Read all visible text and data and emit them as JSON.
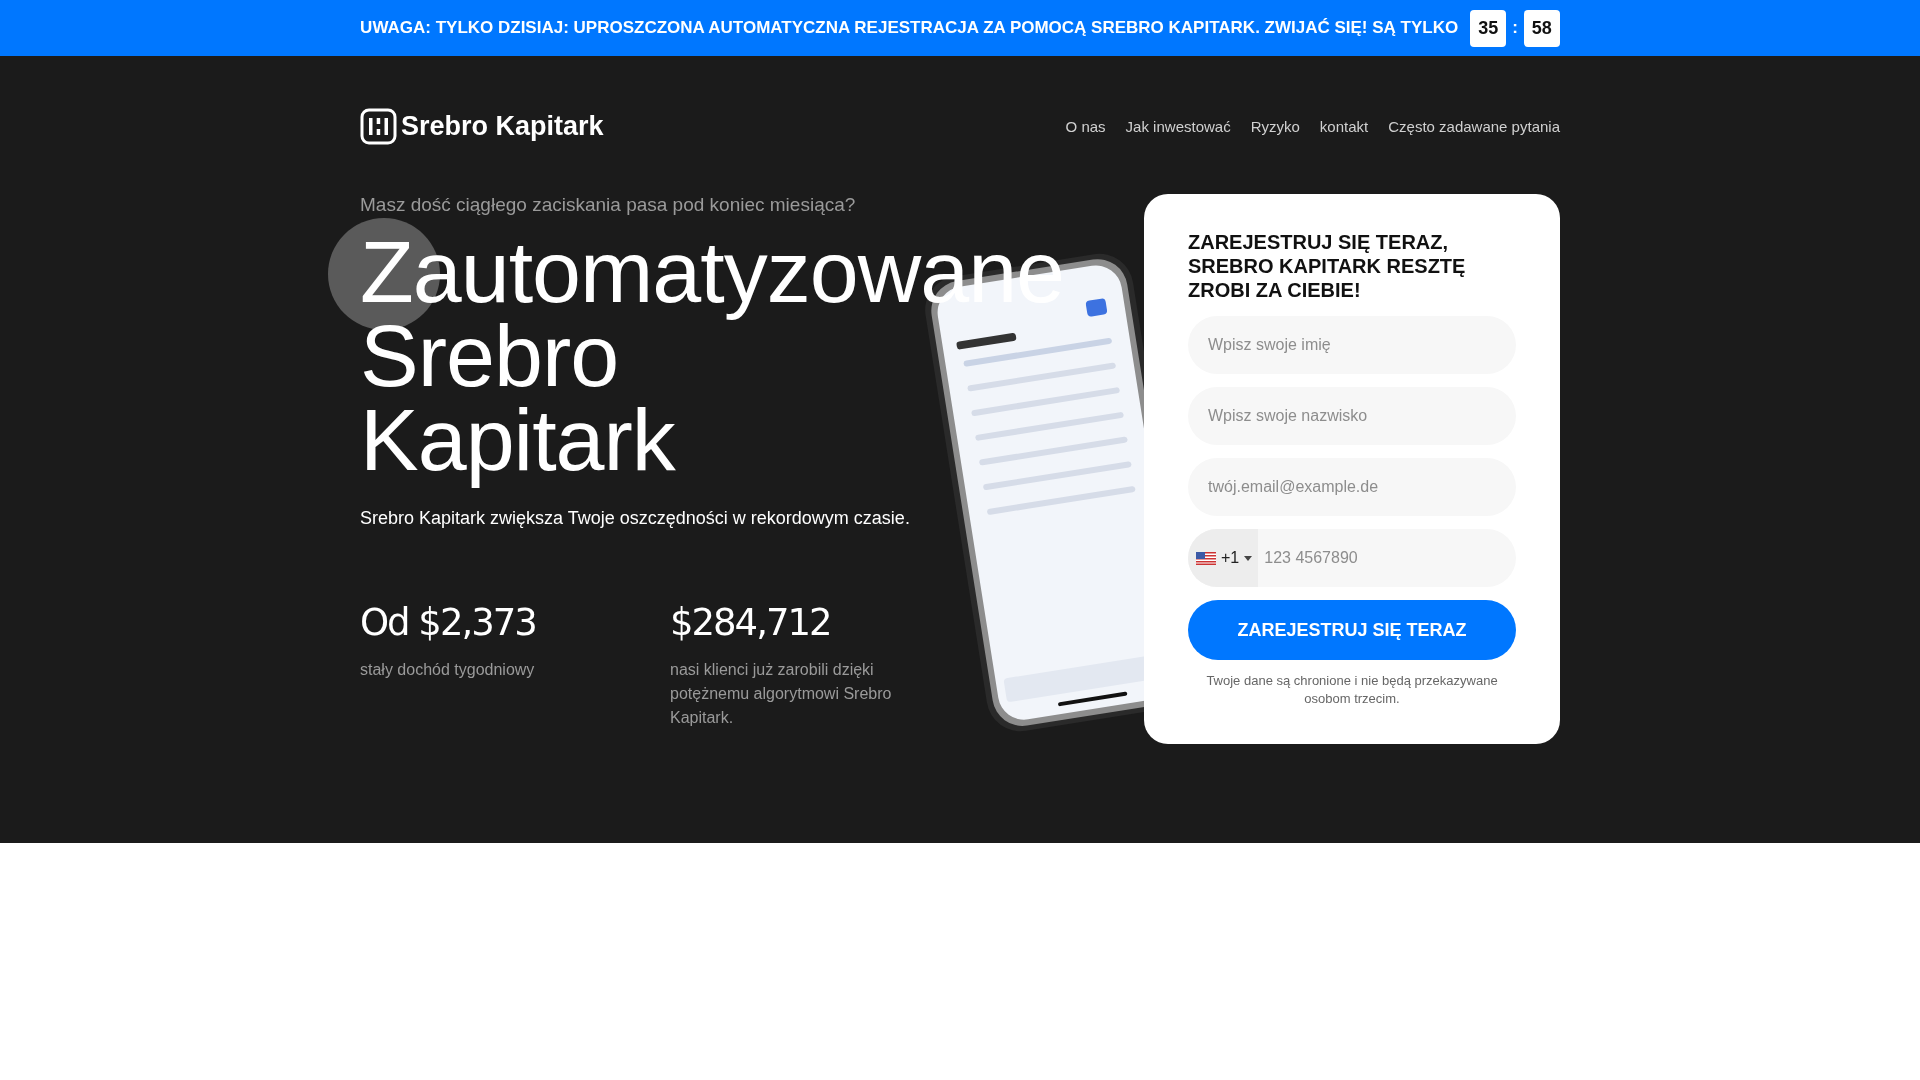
{
  "banner": {
    "text": "UWAGA: TYLKO DZISIAJ: UPROSZCZONA AUTOMATYCZNA REJESTRACJA ZA POMOCĄ SREBRO KAPITARK. ZWIJAĆ SIĘ! SĄ TYLKO",
    "timer": [
      "35",
      "58"
    ],
    "separator": ":"
  },
  "header": {
    "logo": "Srebro Kapitark",
    "nav": [
      "O nas",
      "Jak inwestować",
      "Ryzyko",
      "kontakt",
      "Często zadawane pytania"
    ]
  },
  "hero": {
    "eyebrow": "Masz dość ciągłego zaciskania pasa pod koniec miesiąca?",
    "heading": [
      "Zautomatyzowane",
      "Srebro",
      "Kapitark"
    ],
    "lead": "Srebro Kapitark zwiększa Twoje oszczędności w rekordowym czasie.",
    "stats": [
      {
        "value": "Od $2,373",
        "caption": "stały dochód tygodniowy"
      },
      {
        "value": "$284,712",
        "caption": "nasi klienci już zarobili dzięki potężnemu algorytmowi Srebro Kapitark."
      }
    ],
    "phone": {
      "kind": "picture"
    }
  },
  "form": {
    "title": "ZAREJESTRUJ SIĘ TERAZ, SREBRO KAPITARK RESZTĘ ZROBI ZA CIEBIE!",
    "fields": [
      {
        "kind": "text",
        "placeholder": "Wpisz swoje imię"
      },
      {
        "kind": "text",
        "placeholder": "Wpisz swoje nazwisko"
      },
      {
        "kind": "text",
        "placeholder": "twój.email@example.de"
      },
      {
        "kind": "phone",
        "dial_code": "+1",
        "placeholder": "123 4567890"
      }
    ],
    "submit": "ZAREJESTRUJ SIĘ TERAZ",
    "privacy": "Twoje dane są chronione i nie będą przekazywane osobom trzecim."
  }
}
